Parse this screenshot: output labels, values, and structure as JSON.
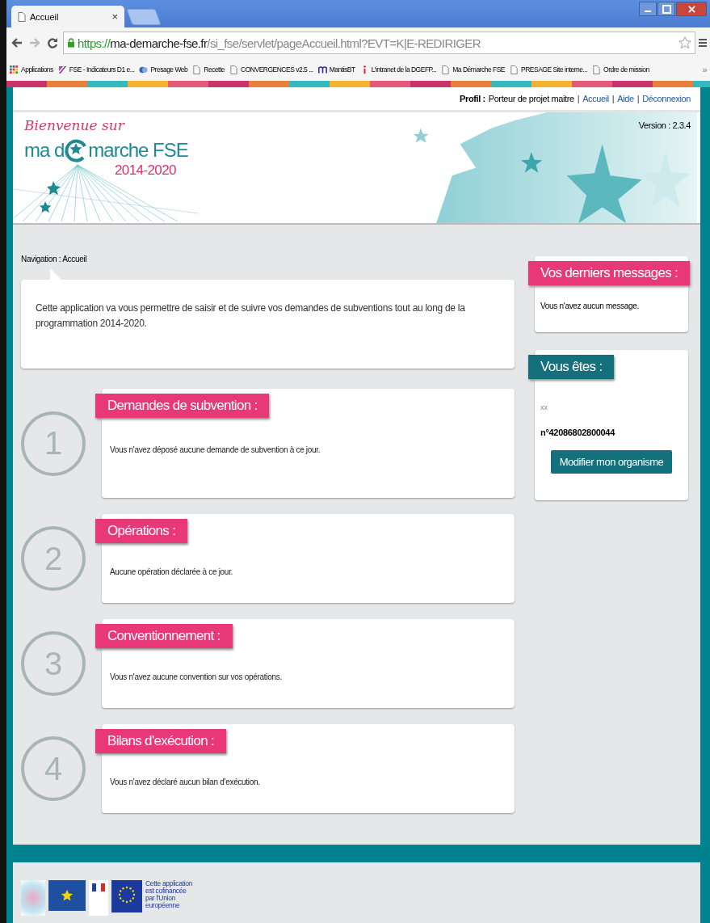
{
  "browser": {
    "tab_title": "Accueil",
    "tab_close": "×",
    "url": {
      "scheme": "https://",
      "host": "ma-demarche-fse.fr",
      "path": "/si_fse/servlet/pageAccueil.html?EVT=K|E-REDIRIGER"
    },
    "bookmarks": [
      {
        "label": "Applications",
        "kind": "apps"
      },
      {
        "label": "FSE - Indicateurs D1 e...",
        "kind": "purple"
      },
      {
        "label": "Presage Web",
        "kind": "dot"
      },
      {
        "label": "Recette",
        "kind": "page"
      },
      {
        "label": "CONVERGENCES v2.5 ...",
        "kind": "page"
      },
      {
        "label": "MantisBT",
        "kind": "mantis"
      },
      {
        "label": "L'intranet de la DGEFP...",
        "kind": "info"
      },
      {
        "label": "Ma Démarche FSE",
        "kind": "page"
      },
      {
        "label": "PRESAGE  Site interne...",
        "kind": "page"
      },
      {
        "label": "Ordre de mission",
        "kind": "page"
      }
    ],
    "more": "»"
  },
  "header": {
    "profile_label": "Profil :",
    "profile_value": "Porteur de projet maitre",
    "separator": "|",
    "links": [
      "Accueil",
      "Aide",
      "Déconnexion"
    ],
    "welcome": "Bienvenue sur",
    "logo_left": "ma d",
    "logo_right": "marche FSE",
    "logo_years": "2014-2020",
    "version": "Version : 2.3.4"
  },
  "breadcrumb": "Navigation : Accueil",
  "intro": "Cette application va vous permettre de saisir et de suivre vos demandes de subventions tout au long de la programmation 2014-2020.",
  "steps": [
    {
      "number": "1",
      "title": "Demandes de subvention :",
      "text": "Vous n'avez déposé aucune demande de subvention à ce jour."
    },
    {
      "number": "2",
      "title": "Opérations :",
      "text": "Aucune opération déclarée à ce jour."
    },
    {
      "number": "3",
      "title": "Conventionnement :",
      "text": "Vous n'avez aucune convention sur vos opérations."
    },
    {
      "number": "4",
      "title": "Bilans d'exécution :",
      "text": "Vous n'avez déclaré aucun bilan d'exécution."
    }
  ],
  "messages": {
    "title": "Vos derniers messages :",
    "text": "Vous n'avez aucun message."
  },
  "identity": {
    "title": "Vous êtes :",
    "name": "xx",
    "number": "n°42086802800044",
    "button": "Modifier mon organisme"
  },
  "footer": {
    "cofinance": "Cette application est cofinancée par l'Union européenne"
  }
}
